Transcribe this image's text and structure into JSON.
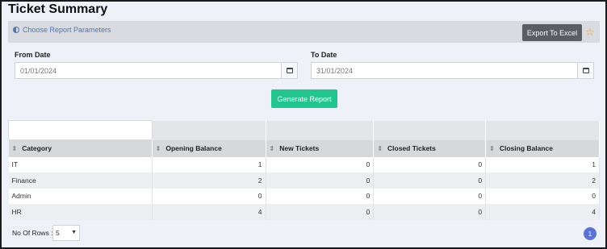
{
  "page": {
    "title": "Ticket Summary"
  },
  "params": {
    "link_label": "Choose Report Parameters",
    "link_icon": "half-circle-icon"
  },
  "toolbar": {
    "export_label": "Export To Excel",
    "favorite_icon": "star-icon",
    "favorite_color": "#e8a23a"
  },
  "form": {
    "from_label": "From Date",
    "from_value": "01/01/2024",
    "to_label": "To Date",
    "to_value": "31/01/2024",
    "calendar_icon": "calendar-icon",
    "generate_label": "Generate Report",
    "generate_color": "#21c58e"
  },
  "table": {
    "columns": [
      "Category",
      "Opening Balance",
      "New Tickets",
      "Closed Tickets",
      "Closing Balance"
    ],
    "rows": [
      [
        "IT",
        "1",
        "0",
        "0",
        "1"
      ],
      [
        "Finance",
        "2",
        "0",
        "0",
        "2"
      ],
      [
        "Admin",
        "0",
        "0",
        "0",
        "0"
      ],
      [
        "HR",
        "4",
        "0",
        "0",
        "4"
      ]
    ]
  },
  "footer": {
    "rows_label": "No Of Rows :",
    "rows_value": "5",
    "current_page": "1",
    "page_color": "#5b73d9"
  }
}
